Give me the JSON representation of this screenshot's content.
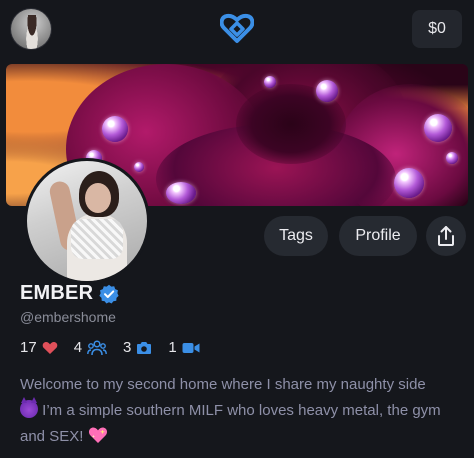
{
  "topbar": {
    "avatar_icon": "user-avatar",
    "logo_icon": "heart-logo-icon",
    "balance": "$0",
    "accent_color": "#3b8fe6"
  },
  "banner": {
    "image": "rose-with-water-drops"
  },
  "actions": {
    "tags_label": "Tags",
    "profile_label": "Profile",
    "share_icon": "share-icon"
  },
  "profile": {
    "name": "EMBER",
    "verified_icon": "verified-badge-icon",
    "handle": "@embershome"
  },
  "stats": {
    "likes": "17",
    "likes_icon": "heart-icon",
    "subscribers": "4",
    "subscribers_icon": "people-icon",
    "photos": "3",
    "photos_icon": "camera-icon",
    "videos": "1",
    "videos_icon": "video-camera-icon",
    "heart_color": "#e0505a",
    "icon_color": "#3b8fe6"
  },
  "bio": {
    "line1": "Welcome to my second home where I share my naughty side",
    "line2": " I’m a simple southern MILF who loves heavy metal, the gym and SEX! ",
    "emoji_1": "smiling-devil-emoji",
    "emoji_2": "sparkling-heart-emoji"
  }
}
